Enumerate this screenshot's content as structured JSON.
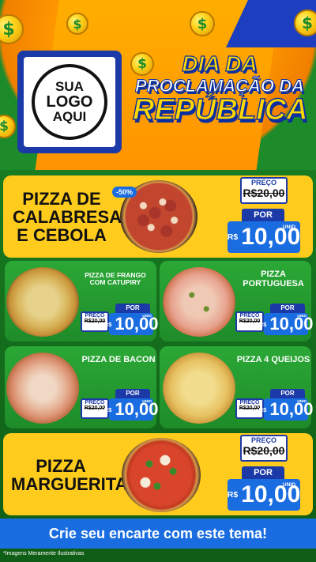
{
  "header": {
    "logo": {
      "line1": "SUA",
      "line2": "LOGO",
      "line3": "AQUI"
    },
    "title": {
      "line1": "DIA DA",
      "line2": "PROCLAMAÇÃO DA",
      "line3": "REPÚBLICA"
    },
    "coin_symbol": "$"
  },
  "featured_top": {
    "name": "PIZZA DE CALABRESA E CEBOLA",
    "discount": "-50%",
    "preco_label": "PREÇO",
    "old_price": "R$20,00",
    "por_label": "POR",
    "currency": "R$",
    "new_price": "10,00",
    "unit": "UNID"
  },
  "grid": [
    {
      "name": "PIZZA DE FRANGO COM CATUPIRY",
      "preco_label": "PREÇO",
      "old_price": "R$20,00",
      "por_label": "POR",
      "currency": "R$",
      "new_price": "10,00",
      "unit": "UNID"
    },
    {
      "name": "PIZZA PORTUGUESA",
      "preco_label": "PREÇO",
      "old_price": "R$20,00",
      "por_label": "POR",
      "currency": "R$",
      "new_price": "10,00",
      "unit": "UNID"
    },
    {
      "name": "PIZZA DE BACON",
      "preco_label": "PREÇO",
      "old_price": "R$20,00",
      "por_label": "POR",
      "currency": "R$",
      "new_price": "10,00",
      "unit": "UNID"
    },
    {
      "name": "PIZZA 4 QUEIJOS",
      "preco_label": "PREÇO",
      "old_price": "R$20,00",
      "por_label": "POR",
      "currency": "R$",
      "new_price": "10,00",
      "unit": "UNID"
    }
  ],
  "featured_bottom": {
    "name": "PIZZA MARGUERITA",
    "preco_label": "PREÇO",
    "old_price": "R$20,00",
    "por_label": "POR",
    "currency": "R$",
    "new_price": "10,00",
    "unit": "UNID"
  },
  "footer": {
    "cta": "Crie seu encarte com este tema!",
    "note": "*Imagens Meramente Ilustrativas"
  },
  "colors": {
    "accent_yellow": "#ffcb1c",
    "green": "#1e8c29",
    "blue": "#1a6de0",
    "navy": "#1b3aa8"
  }
}
